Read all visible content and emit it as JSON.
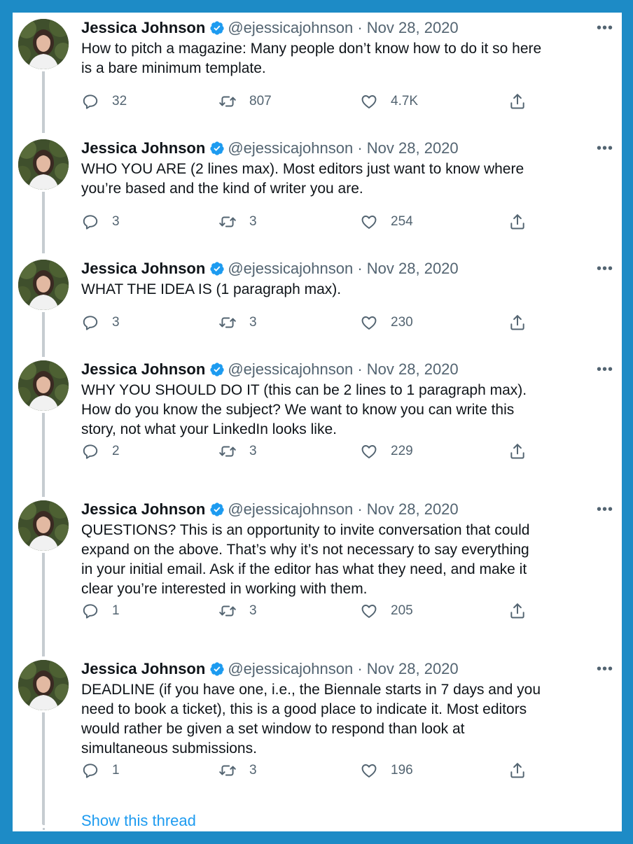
{
  "author": {
    "name": "Jessica Johnson",
    "handle": "@ejessicajohnson",
    "date": "Nov 28, 2020",
    "separator": "·"
  },
  "tweets": [
    {
      "text": "How to pitch a magazine: Many people don’t know how to do it so here\nis a bare minimum template.",
      "replies": "32",
      "retweets": "807",
      "likes": "4.7K"
    },
    {
      "text": "WHO YOU ARE (2 lines max). Most editors just want to know where\nyou’re based and the kind of writer you are.",
      "replies": "3",
      "retweets": "3",
      "likes": "254"
    },
    {
      "text": "WHAT THE IDEA IS (1 paragraph max).",
      "replies": "3",
      "retweets": "3",
      "likes": "230"
    },
    {
      "text": "WHY YOU SHOULD DO IT (this can be 2 lines to 1 paragraph max).\nHow do you know the subject? We want to know you can write this\nstory, not what your LinkedIn looks like.",
      "replies": "2",
      "retweets": "3",
      "likes": "229"
    },
    {
      "text": "QUESTIONS? This is an opportunity to invite conversation that could\nexpand on the above. That’s why it’s not necessary to say everything\nin your initial email. Ask if the editor has what they need, and make it\nclear you’re interested in working with them.",
      "replies": "1",
      "retweets": "3",
      "likes": "205"
    },
    {
      "text": "DEADLINE (if you have one, i.e., the Biennale starts in 7 days and you\nneed to book a ticket), this is a good place to indicate it. Most editors\nwould rather be given a set window to respond than look at\nsimultaneous submissions.",
      "replies": "1",
      "retweets": "3",
      "likes": "196"
    }
  ],
  "show_thread_label": "Show this thread",
  "colors": {
    "border": "#1d8bc6",
    "link": "#1d9bf0",
    "muted": "#536471",
    "text": "#0f1419",
    "verified": "#1d9bf0"
  },
  "icons": [
    "verified-badge-icon",
    "more-icon",
    "reply-icon",
    "retweet-icon",
    "like-icon",
    "share-icon"
  ]
}
